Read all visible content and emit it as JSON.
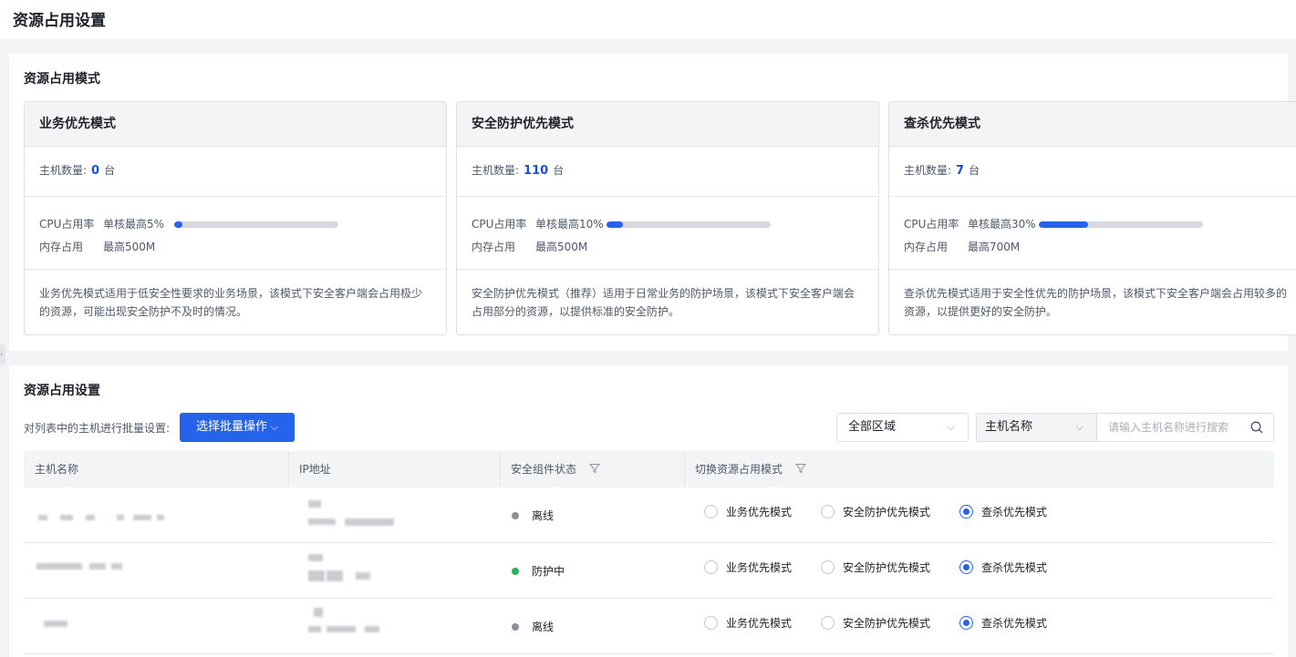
{
  "page": {
    "title": "资源占用设置"
  },
  "modes_section": {
    "title": "资源占用模式",
    "host_count_label": "主机数量:",
    "unit": "台",
    "cpu_label": "CPU占用率",
    "mem_label": "内存占用",
    "cards": [
      {
        "title": "业务优先模式",
        "count": "0",
        "cpu_limit": "单核最高5%",
        "cpu_fraction": 0.05,
        "mem_limit": "最高500M",
        "desc": "业务优先模式适用于低安全性要求的业务场景，该模式下安全客户端会占用极少的资源，可能出现安全防护不及时的情况。"
      },
      {
        "title": "安全防护优先模式",
        "count": "110",
        "cpu_limit": "单核最高10%",
        "cpu_fraction": 0.1,
        "mem_limit": "最高500M",
        "desc": "安全防护优先模式（推荐）适用于日常业务的防护场景，该模式下安全客户端会占用部分的资源，以提供标准的安全防护。"
      },
      {
        "title": "查杀优先模式",
        "count": "7",
        "cpu_limit": "单核最高30%",
        "cpu_fraction": 0.3,
        "mem_limit": "最高700M",
        "desc": "查杀优先模式适用于安全性优先的防护场景，该模式下安全客户端会占用较多的资源，以提供更好的安全防护。"
      }
    ]
  },
  "settings_section": {
    "title": "资源占用设置",
    "batch_label": "对列表中的主机进行批量设置:",
    "batch_button": "选择批量操作",
    "region_select": "全部区域",
    "search_type": "主机名称",
    "search_placeholder": "请输入主机名称进行搜索",
    "columns": [
      "主机名称",
      "IP地址",
      "安全组件状态",
      "切换资源占用模式"
    ],
    "mode_options": [
      "业务优先模式",
      "安全防护优先模式",
      "查杀优先模式"
    ],
    "rows": [
      {
        "status": "离线",
        "status_color": "#8a8f99",
        "selected_mode": 2
      },
      {
        "status": "防护中",
        "status_color": "#22b55a",
        "selected_mode": 2
      },
      {
        "status": "离线",
        "status_color": "#8a8f99",
        "selected_mode": 2
      }
    ]
  }
}
